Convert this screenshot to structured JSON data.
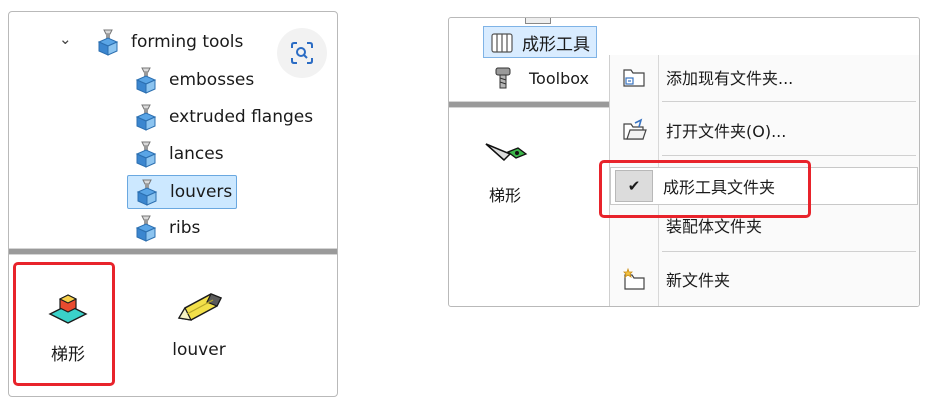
{
  "left": {
    "tree": {
      "root": {
        "label": "forming tools"
      },
      "children": [
        {
          "label": "embosses"
        },
        {
          "label": "extruded flanges"
        },
        {
          "label": "lances"
        },
        {
          "label": "louvers"
        },
        {
          "label": "ribs"
        }
      ]
    },
    "files": [
      {
        "label": "梯形"
      },
      {
        "label": "louver"
      }
    ]
  },
  "right": {
    "tree": {
      "forming_tools": {
        "label": "成形工具"
      },
      "toolbox": {
        "label": "Toolbox"
      }
    },
    "files": [
      {
        "label": "梯形"
      }
    ],
    "context_menu": {
      "items": [
        {
          "label": "添加现有文件夹..."
        },
        {
          "label": "打开文件夹(O)..."
        },
        {
          "label": "成形工具文件夹",
          "checked": true
        },
        {
          "label": "装配体文件夹"
        },
        {
          "label": "新文件夹"
        }
      ]
    }
  },
  "colors": {
    "highlight_border": "#e8232b",
    "selection_bg": "#cce8ff",
    "selection_border": "#6aa8e0"
  }
}
